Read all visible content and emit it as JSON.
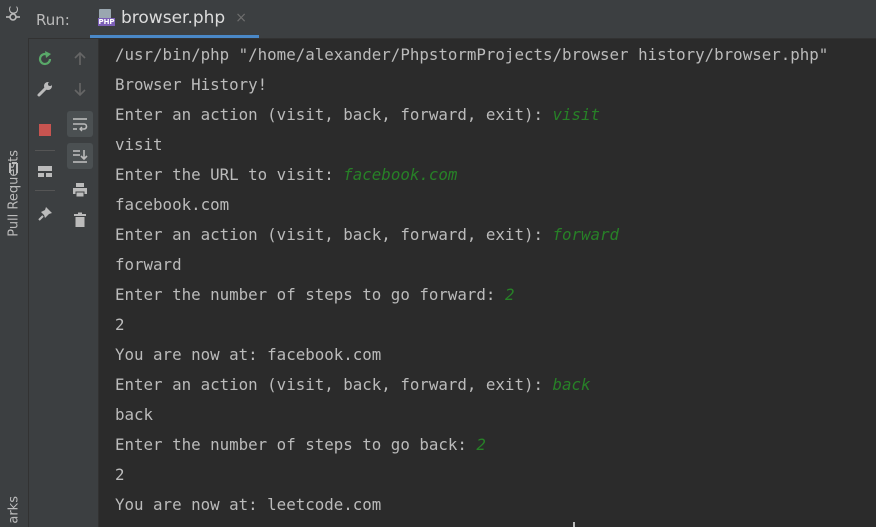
{
  "side": {
    "top_label": "C",
    "pull_requests": "Pull Requests",
    "bookmarks_partial": "arks"
  },
  "header": {
    "run_label": "Run:",
    "tab_label": "browser.php",
    "tab_icon_badge": "PHP",
    "tab_close": "×"
  },
  "toolbar": {
    "rerun": "rerun-icon",
    "settings": "wrench-icon",
    "stop": "stop-icon",
    "layout": "layout-icon",
    "pin": "pin-icon",
    "up": "arrow-up-icon",
    "down": "arrow-down-icon",
    "soft_wrap": "soft-wrap-icon",
    "scroll_end": "scroll-to-end-icon",
    "print": "print-icon",
    "trash": "trash-icon"
  },
  "colors": {
    "background": "#2b2b2b",
    "panel": "#3c3f41",
    "text": "#bbbbbb",
    "user_input": "#278027",
    "stop_red": "#c75450",
    "rerun_green": "#59a869",
    "tab_underline": "#4a88c7"
  },
  "console": {
    "lines": [
      {
        "text": "/usr/bin/php \"/home/alexander/PhpstormProjects/browser history/browser.php\"",
        "input": ""
      },
      {
        "text": "Browser History!",
        "input": ""
      },
      {
        "text": "Enter an action (visit, back, forward, exit): ",
        "input": "visit"
      },
      {
        "text": "visit",
        "input": ""
      },
      {
        "text": "Enter the URL to visit: ",
        "input": "facebook.com"
      },
      {
        "text": "facebook.com",
        "input": ""
      },
      {
        "text": "Enter an action (visit, back, forward, exit): ",
        "input": "forward"
      },
      {
        "text": "forward",
        "input": ""
      },
      {
        "text": "Enter the number of steps to go forward: ",
        "input": "2"
      },
      {
        "text": "2",
        "input": ""
      },
      {
        "text": "You are now at: facebook.com",
        "input": ""
      },
      {
        "text": "Enter an action (visit, back, forward, exit): ",
        "input": "back"
      },
      {
        "text": "back",
        "input": ""
      },
      {
        "text": "Enter the number of steps to go back: ",
        "input": "2"
      },
      {
        "text": "2",
        "input": ""
      },
      {
        "text": "You are now at: leetcode.com",
        "input": ""
      }
    ]
  }
}
